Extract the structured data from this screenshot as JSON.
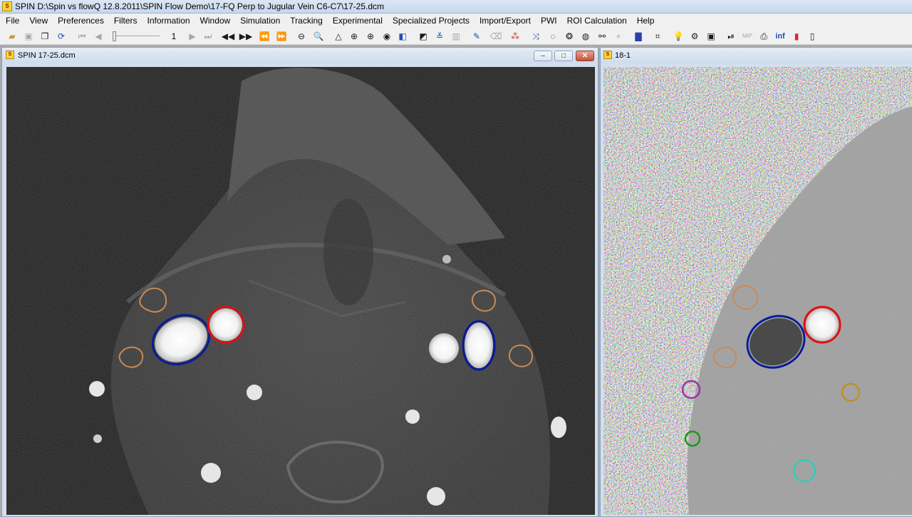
{
  "window": {
    "title": "SPIN D:\\Spin vs flowQ 12.8.2011\\SPIN Flow Demo\\17-FQ Perp to Jugular Vein C6-C7\\17-25.dcm"
  },
  "menu": [
    "File",
    "View",
    "Preferences",
    "Filters",
    "Information",
    "Window",
    "Simulation",
    "Tracking",
    "Experimental",
    "Specialized Projects",
    "Import/Export",
    "PWI",
    "ROI Calculation",
    "Help"
  ],
  "toolbar": {
    "frame_number": "1",
    "info_label": "inf",
    "mip_label": "MIP"
  },
  "child_windows": {
    "left": {
      "title": "SPIN 17-25.dcm",
      "minimize": "–",
      "maximize": "□",
      "close": "✕"
    },
    "right": {
      "title": "18-1"
    }
  },
  "roi_colors": {
    "artery": "#e01010",
    "vein": "#0a1a9a",
    "background": "#c98a55",
    "magenta": "#a030a0",
    "green": "#1a9a1a",
    "cyan": "#20d0c0",
    "gold": "#c09020"
  },
  "icons": {
    "app": "SPIN",
    "open": "open-folder-icon",
    "save": "save-icon",
    "copy": "copy-icon",
    "refresh": "refresh-icon"
  }
}
